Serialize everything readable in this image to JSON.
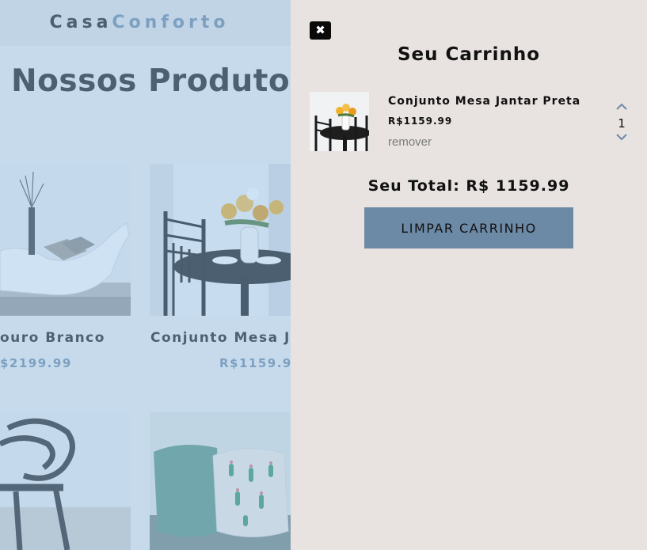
{
  "header": {
    "brand_part1": "Casa",
    "brand_part2": "Conforto"
  },
  "main": {
    "section_title": "Nossos Produtos",
    "products": [
      {
        "name": "ouro Branco",
        "price": "$2199.99"
      },
      {
        "name": "Conjunto Mesa Jan",
        "price": "R$1159.99"
      },
      {
        "name": "",
        "price": ""
      },
      {
        "name": "",
        "price": ""
      }
    ]
  },
  "cart": {
    "close_label": "✖",
    "title": "Seu Carrinho",
    "items": [
      {
        "name": "Conjunto Mesa Jantar Preta",
        "price": "R$1159.99",
        "remove_label": "remover",
        "quantity": "1"
      }
    ],
    "total_label": "Seu Total: R$ 1159.99",
    "clear_button_label": "LIMPAR CARRINHO"
  },
  "colors": {
    "brand_accent": "#748ea8",
    "overlay_tint": "#8ab9e4",
    "cart_background": "#e8e3e0",
    "clear_button": "#6c89a5"
  },
  "icons": {
    "close": "close-icon",
    "qty_up": "chevron-up-icon",
    "qty_down": "chevron-down-icon"
  }
}
